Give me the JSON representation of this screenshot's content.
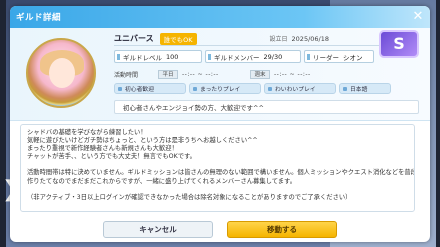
{
  "header": {
    "title": "ギルド詳細",
    "close_label": "✕"
  },
  "guild": {
    "name": "ユニバース",
    "join_badge": "誰でもOK",
    "established_label": "設立日",
    "established_date": "2025/06/18",
    "rank": "S",
    "stats": [
      {
        "label": "ギルドレベル",
        "value": "100"
      },
      {
        "label": "ギルドメンバー",
        "value": "29/30"
      },
      {
        "label": "リーダー",
        "value": "シオン"
      }
    ],
    "activity_label": "活動時間",
    "weekday_label": "平日",
    "weekday_time": "--:-- ~ --:--",
    "weekend_label": "週末",
    "weekend_time": "--:-- ~ --:--",
    "tags": [
      "初心者歓迎",
      "まったりプレイ",
      "わいわいプレイ",
      "日本語"
    ],
    "short_description": "初心者さんやエンジョイ勢の方、大歓迎です^^"
  },
  "body_lines": [
    "シャドバの基礎を学びながら練習したい！",
    "気軽に遊びたいけどガチ勢はちょっと、という方は是非うちへお越しください^^",
    "まったり重視で新作経験者さんも新規さんも大歓迎！",
    "チャットが苦手、、という方でも大丈夫！無言でもOKです。",
    "",
    "活動時間帯は特に決めていません。ギルドミッションは皆さんの無理のない範囲で構いません。個人ミッションやクエスト消化などを普段通りでお手伝いします！",
    "作りたてなのでまだまだこれからですが、一緒に盛り上げてくれるメンバーさん募集してます。",
    "",
    "（非アクティブ・3日以上ログインが確認できなかった場合は除名対象になることがありますのでご了承ください）"
  ],
  "buttons": {
    "cancel": "キャンセル",
    "move": "移動する"
  }
}
